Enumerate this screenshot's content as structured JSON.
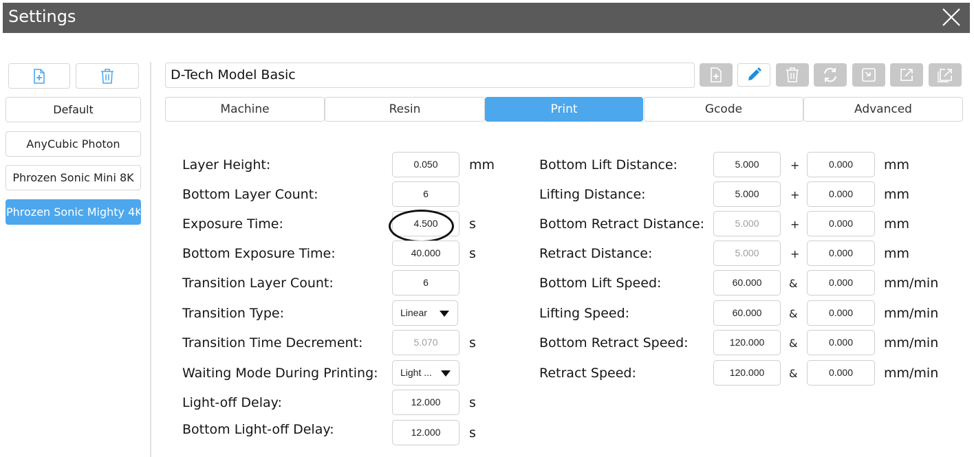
{
  "window": {
    "title": "Settings"
  },
  "profiles": [
    "Default",
    "AnyCubic Photon",
    "Phrozen Sonic Mini 8K",
    "Phrozen Sonic Mighty 4K"
  ],
  "profile_name": "D-Tech Model Basic",
  "tabs": [
    "Machine",
    "Resin",
    "Print",
    "Gcode",
    "Advanced"
  ],
  "active_tab": "Print",
  "left_params": [
    {
      "label": "Layer Height:",
      "value": "0.050",
      "unit": "mm"
    },
    {
      "label": "Bottom Layer Count:",
      "value": "6",
      "unit": ""
    },
    {
      "label": "Exposure Time:",
      "value": "4.500",
      "unit": "s"
    },
    {
      "label": "Bottom Exposure Time:",
      "value": "40.000",
      "unit": "s"
    },
    {
      "label": "Transition Layer Count:",
      "value": "6",
      "unit": ""
    },
    {
      "label": "Transition Type:",
      "value": "Linear",
      "unit": ""
    },
    {
      "label": "Transition Time Decrement:",
      "value": "5.070",
      "unit": "s"
    },
    {
      "label": "Waiting Mode During Printing:",
      "value": "Light ...",
      "unit": ""
    },
    {
      "label": "Light-off Delay:",
      "value": "12.000",
      "unit": "s"
    },
    {
      "label": "Bottom Light-off Delay:",
      "value": "12.000",
      "unit": "s"
    }
  ],
  "right_params": [
    {
      "label": "Bottom Lift Distance:",
      "value1": "5.000",
      "op": "+",
      "value2": "0.000",
      "unit": "mm"
    },
    {
      "label": "Lifting Distance:",
      "value1": "5.000",
      "op": "+",
      "value2": "0.000",
      "unit": "mm"
    },
    {
      "label": "Bottom Retract Distance:",
      "value1": "5.000",
      "op": "+",
      "value2": "0.000",
      "unit": "mm"
    },
    {
      "label": "Retract Distance:",
      "value1": "5.000",
      "op": "+",
      "value2": "0.000",
      "unit": "mm"
    },
    {
      "label": "Bottom Lift Speed:",
      "value1": "60.000",
      "op": "&",
      "value2": "0.000",
      "unit": "mm/min"
    },
    {
      "label": "Lifting Speed:",
      "value1": "60.000",
      "op": "&",
      "value2": "0.000",
      "unit": "mm/min"
    },
    {
      "label": "Bottom Retract Speed:",
      "value1": "120.000",
      "op": "&",
      "value2": "0.000",
      "unit": "mm/min"
    },
    {
      "label": "Retract Speed:",
      "value1": "120.000",
      "op": "&",
      "value2": "0.000",
      "unit": "mm/min"
    }
  ],
  "colors": {
    "titlebar": "#5a5a5a",
    "accent": "#4da7ed",
    "toolbar_disabled": "#c8c8c8",
    "dim_text": "#a0a0a0"
  },
  "toolbar_icons": [
    "add-file-icon",
    "edit-pencil-icon",
    "delete-icon",
    "refresh-icon",
    "import-icon",
    "export-icon",
    "export-all-icon"
  ]
}
